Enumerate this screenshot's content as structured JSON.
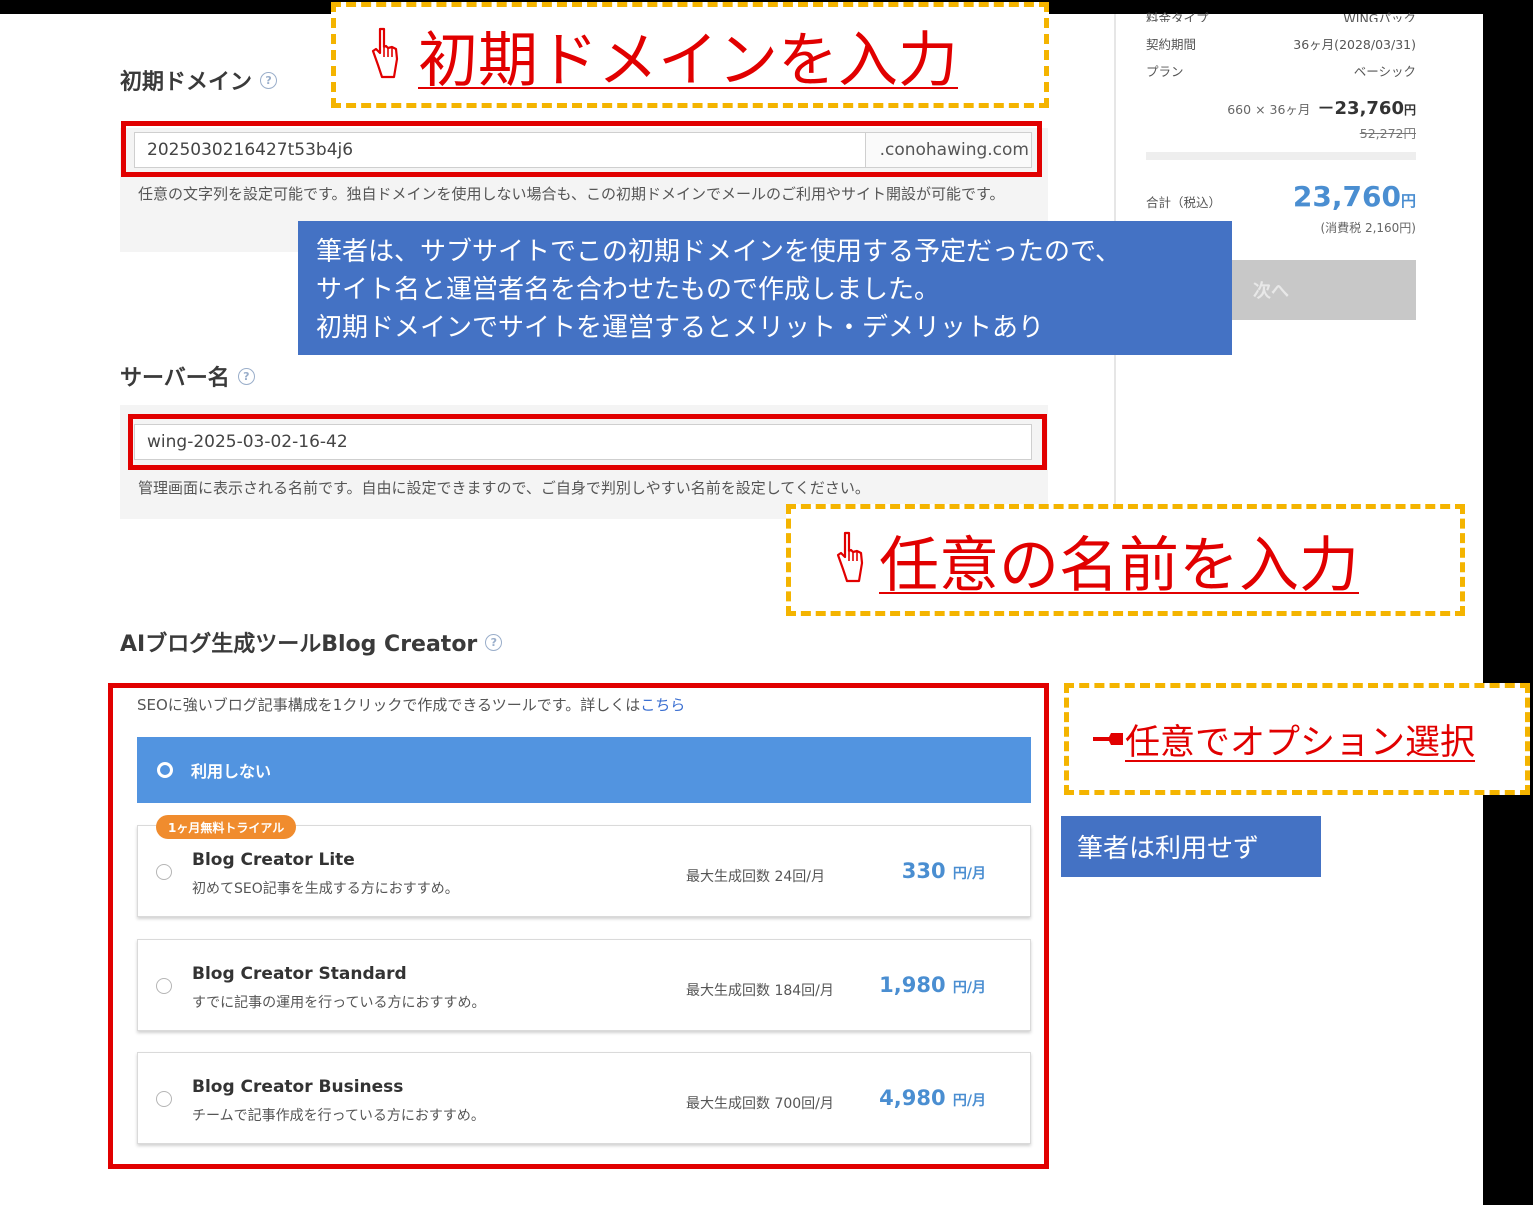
{
  "domain_section": {
    "label": "初期ドメイン",
    "help_icon": "?",
    "input_value": "2025030216427t53b4j6",
    "suffix": ".conohawing.com",
    "note": "任意の文字列を設定可能です。独自ドメインを使用しない場合も、この初期ドメインでメールのご利用やサイト開設が可能です。"
  },
  "server_section": {
    "label": "サーバー名",
    "help_icon": "?",
    "input_value": "wing-2025-03-02-16-42",
    "note": "管理画面に表示される名前です。自由に設定できますので、ご自身で判別しやすい名前を設定してください。"
  },
  "blog_section": {
    "label": "AIブログ生成ツールBlog Creator",
    "help_icon": "?",
    "intro": "SEOに強いブログ記事構成を1クリックで作成できるツールです。詳しくは",
    "intro_link": "こちら",
    "none_option": "利用しない",
    "trial_badge": "1ヶ月無料トライアル",
    "options": [
      {
        "title": "Blog Creator Lite",
        "desc": "初めてSEO記事を生成する方におすすめ。",
        "max": "最大生成回数 24回/月",
        "price": "330",
        "unit": "円/月"
      },
      {
        "title": "Blog Creator Standard",
        "desc": "すでに記事の運用を行っている方におすすめ。",
        "max": "最大生成回数 184回/月",
        "price": "1,980",
        "unit": "円/月"
      },
      {
        "title": "Blog Creator Business",
        "desc": "チームで記事作成を行っている方におすすめ。",
        "max": "最大生成回数 700回/月",
        "price": "4,980",
        "unit": "円/月"
      }
    ]
  },
  "sidebar": {
    "row0_label": "料金タイプ",
    "row0_value": "WINGパック",
    "row1_label": "契約期間",
    "row1_value": "36ヶ月(2028/03/31)",
    "row2_label": "プラン",
    "row2_value": "ベーシック",
    "calc": "660 × 36ヶ月",
    "discounted": "23,760",
    "discount_sign": "－",
    "yen": "円",
    "original": "52,272円",
    "total_label": "合計（税込）",
    "total": "23,760",
    "tax": "(消費税 2,160円)",
    "next_button": "次へ"
  },
  "annotations": {
    "banner_domain": "初期ドメインを入力",
    "banner_name": "任意の名前を入力",
    "banner_option": "任意でオプション選択",
    "callout_lines": [
      "筆者は、サブサイトでこの初期ドメインを使用する予定だったので、",
      "サイト名と運営者名を合わせたもので作成しました。",
      "初期ドメインでサイトを運営するとメリット・デメリットあり"
    ],
    "callout_small": "筆者は利用せず"
  },
  "colors": {
    "red": "#e10000",
    "yellow": "#f4b400",
    "callout_blue": "#4472c4",
    "selected_blue": "#5294e0",
    "price_blue": "#4a8ed1",
    "badge_orange": "#f08c2e"
  },
  "icons": [
    "pointing-hand-icon",
    "help-circle-icon",
    "pointing-left-hand-icon"
  ]
}
